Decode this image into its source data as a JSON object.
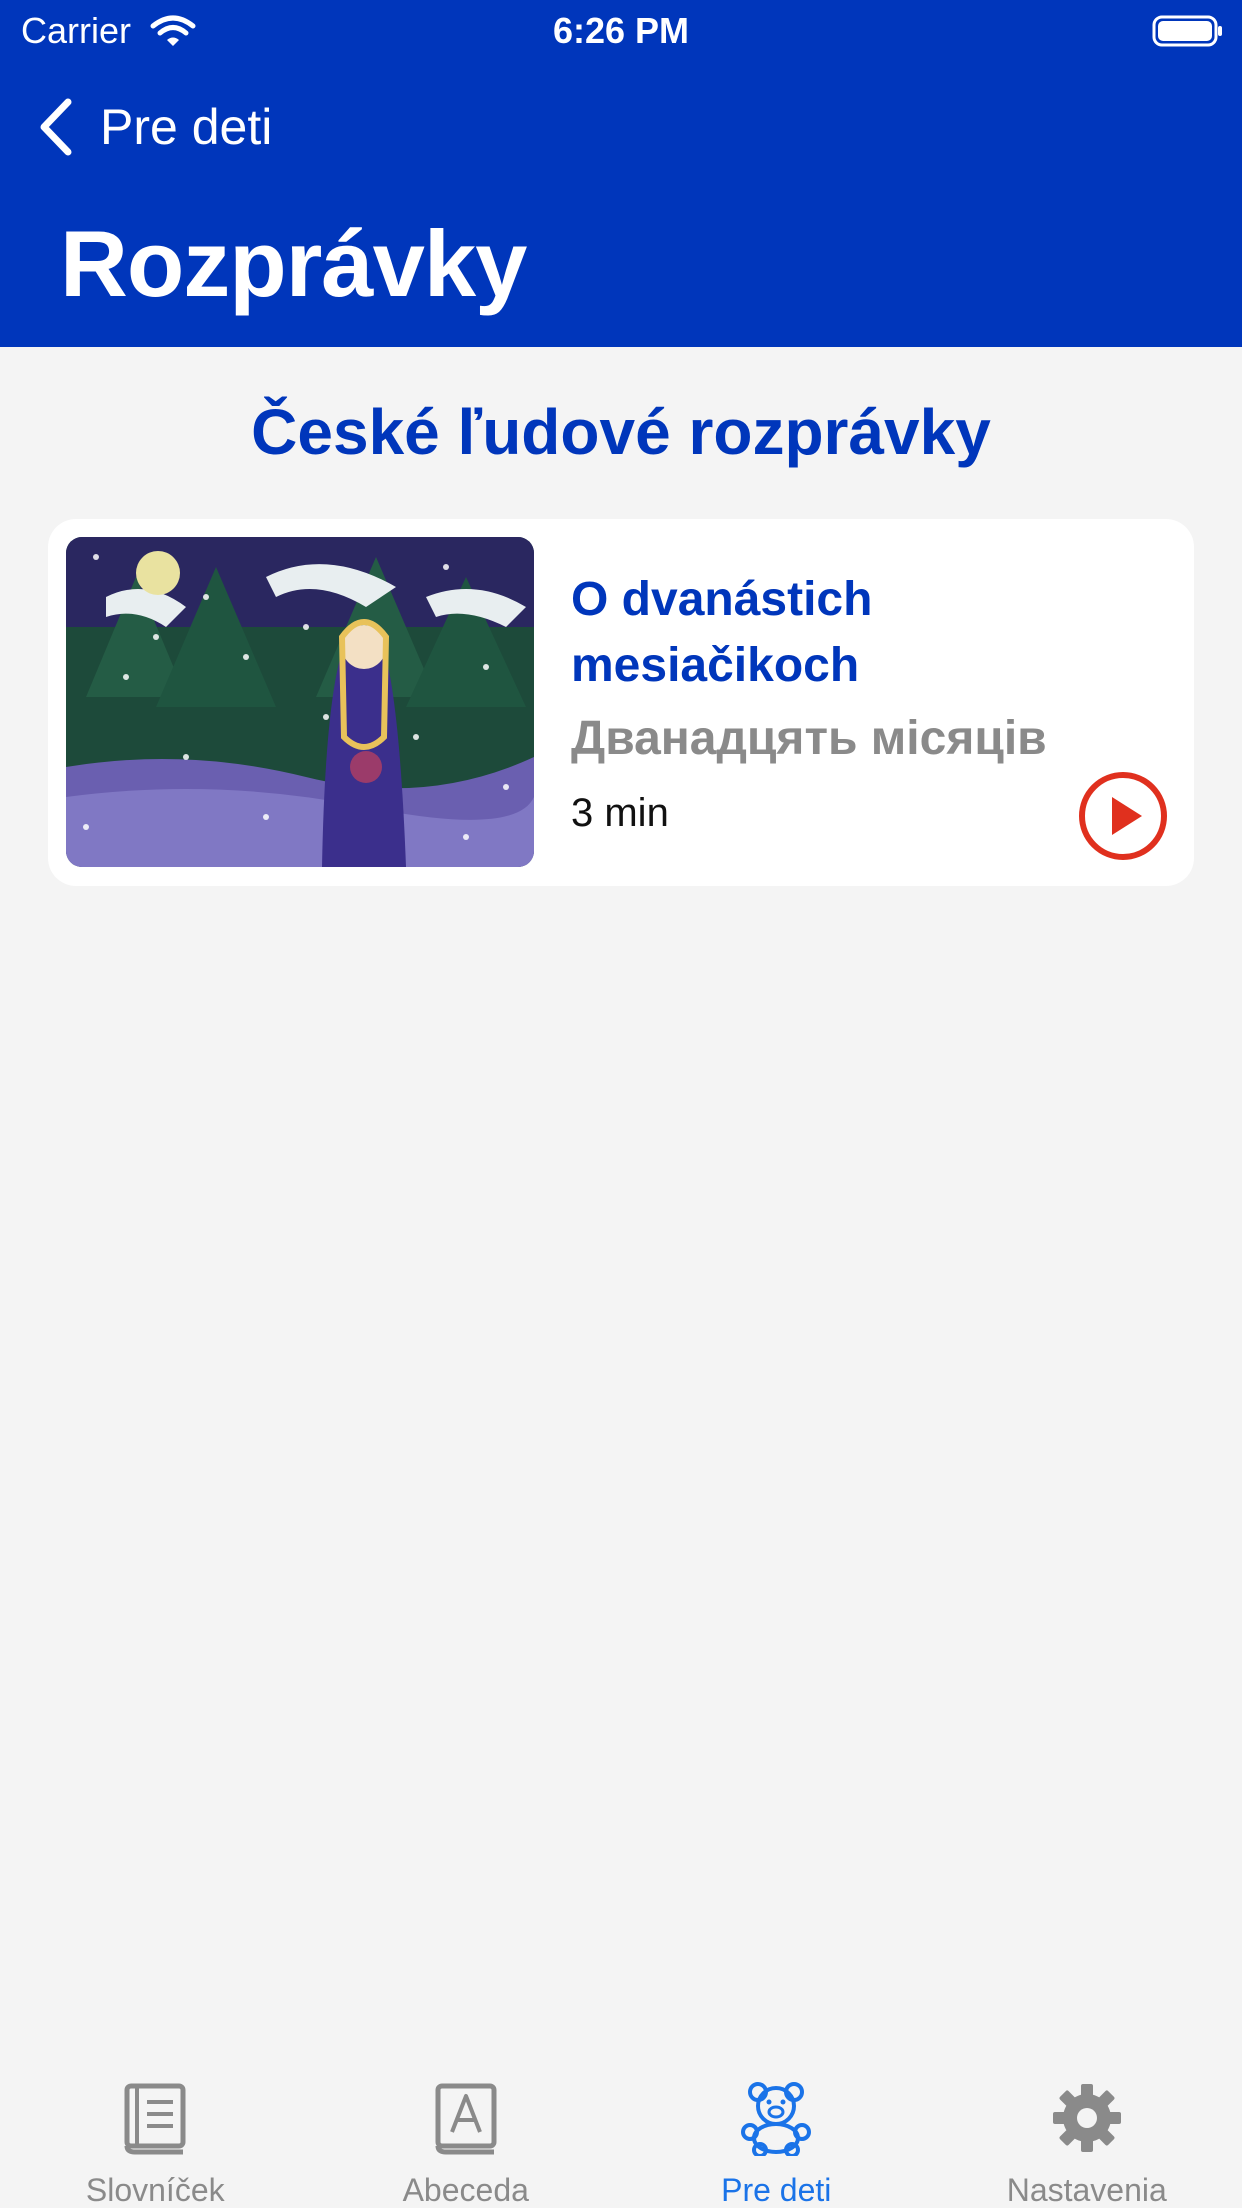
{
  "status_bar": {
    "carrier": "Carrier",
    "time": "6:26 PM"
  },
  "nav": {
    "back_label": "Pre deti",
    "title": "Rozprávky"
  },
  "section": {
    "title": "České ľudové rozprávky"
  },
  "story": {
    "title": "O dvanástich mesiačikoch",
    "subtitle": "Дванадцять місяців",
    "duration": "3 min"
  },
  "tabs": [
    {
      "label": "Slovníček",
      "icon": "book-icon",
      "active": false
    },
    {
      "label": "Abeceda",
      "icon": "alphabet-book-icon",
      "active": false
    },
    {
      "label": "Pre deti",
      "icon": "teddy-bear-icon",
      "active": true
    },
    {
      "label": "Nastavenia",
      "icon": "gear-icon",
      "active": false
    }
  ],
  "colors": {
    "header_bg": "#0036bb",
    "accent_blue": "#0036bb",
    "tab_active": "#1a73e8",
    "play_red": "#e0301e",
    "background": "#f4f4f4"
  }
}
